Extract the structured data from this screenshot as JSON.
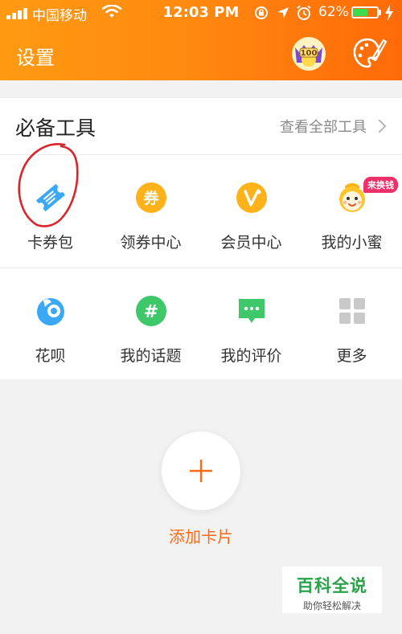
{
  "status_bar": {
    "carrier": "中国移动",
    "time": "12:03 PM",
    "battery_percent": "62%",
    "battery_level": 0.62
  },
  "header": {
    "title": "设置",
    "medal_text": "100",
    "colors": {
      "gradient_start": "#ff9a12",
      "gradient_end": "#ff6a08"
    }
  },
  "tools": {
    "title": "必备工具",
    "view_all": "查看全部工具",
    "rows": [
      [
        {
          "label": "卡券包",
          "icon": "coupon-ticket-icon",
          "color": "#3aa8f5"
        },
        {
          "label": "领券中心",
          "icon": "coupon-center-icon",
          "color": "#ffb21a",
          "glyph": "券"
        },
        {
          "label": "会员中心",
          "icon": "vip-icon",
          "color": "#ffb21a",
          "glyph": "V"
        },
        {
          "label": "我的小蜜",
          "icon": "assistant-bee-icon",
          "color": "#ffb21a"
        }
      ],
      [
        {
          "label": "花呗",
          "icon": "huabei-icon",
          "color": "#3aa8f5"
        },
        {
          "label": "我的话题",
          "icon": "topic-hashtag-icon",
          "color": "#3fc86a",
          "glyph": "#"
        },
        {
          "label": "我的评价",
          "icon": "review-chat-icon",
          "color": "#3fc86a"
        },
        {
          "label": "更多",
          "icon": "more-grid-icon",
          "color": "#c9c9c9"
        }
      ]
    ],
    "more_badge": "来换钱"
  },
  "add_card": {
    "label": "添加卡片",
    "accent": "#ff6a12"
  },
  "watermark": {
    "title": "百科全说",
    "subtitle": "助你轻松解决"
  }
}
